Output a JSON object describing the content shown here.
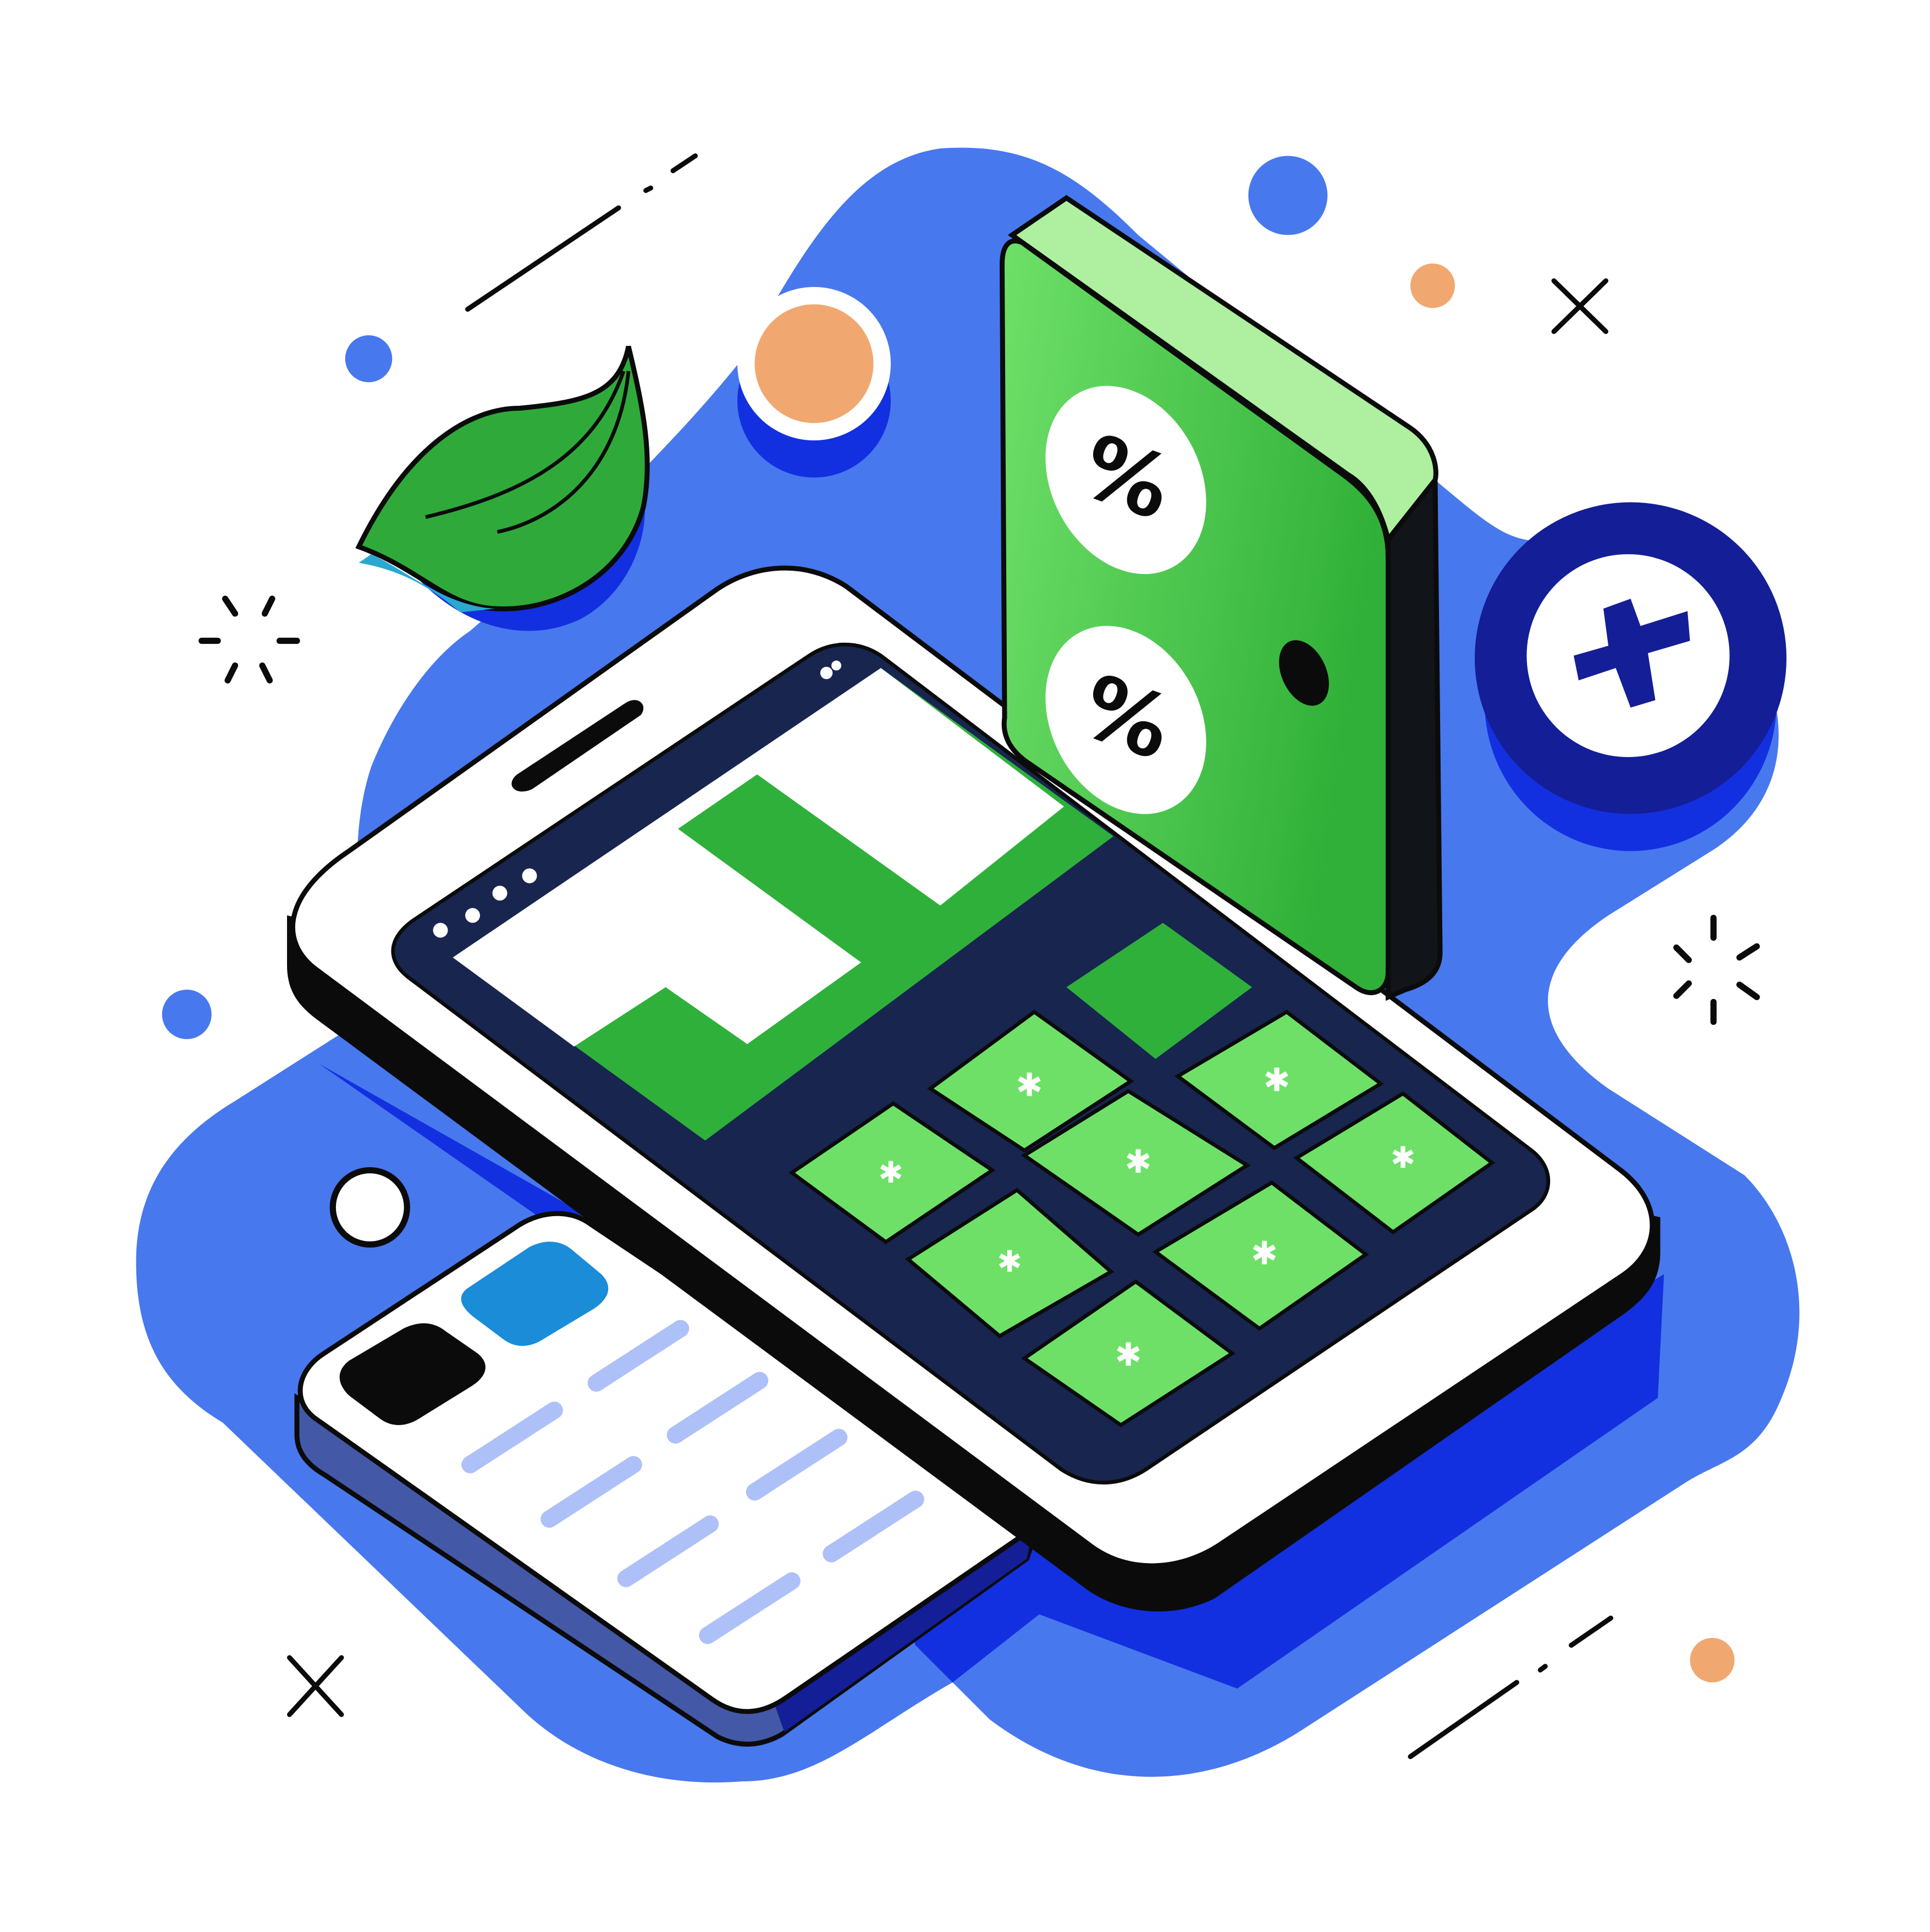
{
  "illustration": {
    "subject": "phone-with-calculator-keypad",
    "percent_glyph": "%",
    "colors": {
      "background": "#ffffff",
      "blob": "#4878ee",
      "blob_shadow": "#1230e0",
      "outline": "#0b0b0b",
      "phone_body": "#ffffff",
      "screen": "#17254f",
      "key_green": "#6ee068",
      "display_green": "#2fb03a",
      "panel_green": "#4fc94a",
      "panel_top": "#aef0a0",
      "panel_side": "#111418",
      "leaf": "#2faa3a",
      "orange": "#f0a870",
      "navy_badge": "#141e96",
      "card_line": "#aec0f8",
      "card_accent": "#1a8cd8"
    },
    "icons": [
      "phone-icon",
      "calculator-panel-icon",
      "percent-icon",
      "plus-badge-icon",
      "leaf-icon",
      "card-icon",
      "sparkle-icon",
      "cross-icon",
      "dot-icon"
    ]
  }
}
